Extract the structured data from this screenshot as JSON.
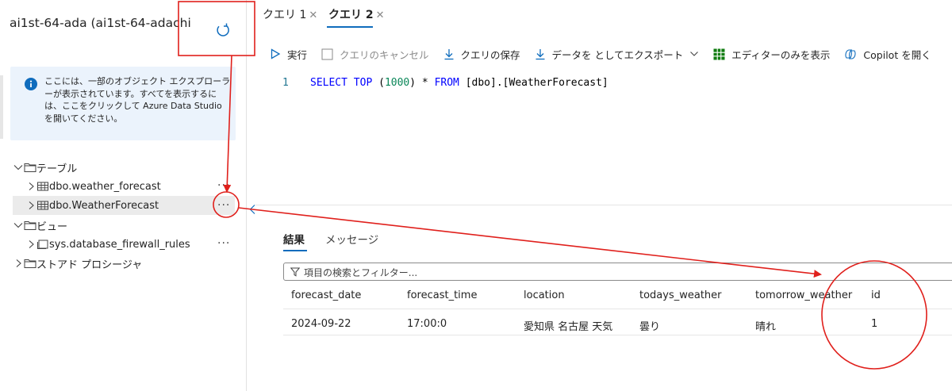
{
  "left_panel": {
    "db_title": "ai1st-64-ada (ai1st-64-adachi",
    "info_text": "ここには、一部のオブジェクト エクスプローラーが表示されています。すべてを表示するには、ここをクリックして Azure Data Studio を開いてください。",
    "tree": {
      "tables_label": "テーブル",
      "tables": [
        "dbo.weather_forecast",
        "dbo.WeatherForecast"
      ],
      "views_label": "ビュー",
      "views": [
        "sys.database_firewall_rules"
      ],
      "procs_label": "ストアド プロシージャ"
    },
    "more_label": "···"
  },
  "tabs": [
    {
      "label": "クエリ 1",
      "close": "✕"
    },
    {
      "label": "クエリ 2",
      "close": "✕"
    }
  ],
  "toolbar": {
    "run": "実行",
    "cancel": "クエリのキャンセル",
    "save": "クエリの保存",
    "export": "データを としてエクスポート",
    "editor_only": "エディターのみを表示",
    "copilot": "Copilot を開く"
  },
  "editor": {
    "line_number": "1",
    "sql": {
      "select": "SELECT",
      "top": "TOP",
      "open": "(",
      "n": "1000",
      "close": ")",
      "star": "*",
      "from": "FROM",
      "target": "[dbo].[WeatherForecast]"
    }
  },
  "results": {
    "tab_results": "結果",
    "tab_messages": "メッセージ",
    "filter_placeholder": "項目の検索とフィルター...",
    "columns": [
      "forecast_date",
      "forecast_time",
      "location",
      "todays_weather",
      "tomorrow_weather",
      "id"
    ],
    "rows": [
      [
        "2024-09-22",
        "17:00:0",
        "愛知県 名古屋 天気",
        "曇り",
        "晴れ",
        "1"
      ]
    ]
  },
  "colors": {
    "accent": "#0f6cbd",
    "annotation": "#e0201c",
    "info_bg": "#ebf3fc",
    "keyword": "#0000ff"
  }
}
